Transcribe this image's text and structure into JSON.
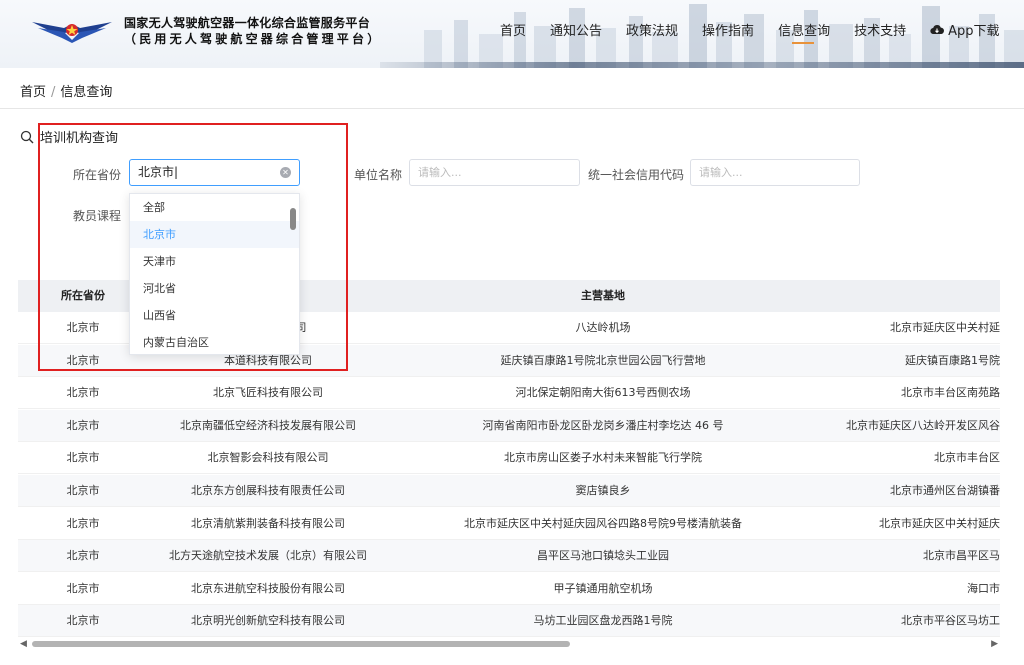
{
  "header": {
    "brand_line1": "国家无人驾驶航空器一体化综合监管服务平台",
    "brand_line2": "（民用无人驾驶航空器综合管理平台）",
    "nav": [
      "首页",
      "通知公告",
      "政策法规",
      "操作指南",
      "信息查询",
      "技术支持"
    ],
    "app_download": "App下载",
    "active_nav": "信息查询"
  },
  "breadcrumb": {
    "home": "首页",
    "sep": "/",
    "current": "信息查询"
  },
  "panel": {
    "title": "培训机构查询",
    "province_label": "所在省份",
    "province_value": "北京市",
    "unit_label": "单位名称",
    "unit_placeholder": "请输入...",
    "credit_label": "统一社会信用代码",
    "credit_placeholder": "请输入...",
    "course_label": "教员课程"
  },
  "dropdown": {
    "options": [
      "全部",
      "北京市",
      "天津市",
      "河北省",
      "山西省",
      "内蒙古自治区"
    ],
    "selected": "北京市"
  },
  "table": {
    "headers": [
      "所在省份",
      "",
      "主营基地",
      ""
    ],
    "rows": [
      [
        "北京市",
        "技发展有限公司",
        "八达岭机场",
        "北京市延庆区中关村延"
      ],
      [
        "北京市",
        "本道科技有限公司",
        "延庆镇百康路1号院北京世园公园飞行营地",
        "延庆镇百康路1号院"
      ],
      [
        "北京市",
        "北京飞匠科技有限公司",
        "河北保定朝阳南大街613号西侧农场",
        "北京市丰台区南苑路"
      ],
      [
        "北京市",
        "北京南疆低空经济科技发展有限公司",
        "河南省南阳市卧龙区卧龙岗乡潘庄村李圪达 46 号",
        "北京市延庆区八达岭开发区风谷"
      ],
      [
        "北京市",
        "北京智影会科技有限公司",
        "北京市房山区娄子水村未来智能飞行学院",
        "北京市丰台区"
      ],
      [
        "北京市",
        "北京东方创展科技有限责任公司",
        "窦店镇良乡",
        "北京市通州区台湖镇番"
      ],
      [
        "北京市",
        "北京清航紫荆装备科技有限公司",
        "北京市延庆区中关村延庆园风谷四路8号院9号楼清航装备",
        "北京市延庆区中关村延庆"
      ],
      [
        "北京市",
        "北方天途航空技术发展（北京）有限公司",
        "昌平区马池口镇埝头工业园",
        "北京市昌平区马"
      ],
      [
        "北京市",
        "北京东进航空科技股份有限公司",
        "甲子镇通用航空机场",
        "海口市"
      ],
      [
        "北京市",
        "北京明光创新航空科技有限公司",
        "马坊工业园区盘龙西路1号院",
        "北京市平谷区马坊工"
      ]
    ]
  }
}
